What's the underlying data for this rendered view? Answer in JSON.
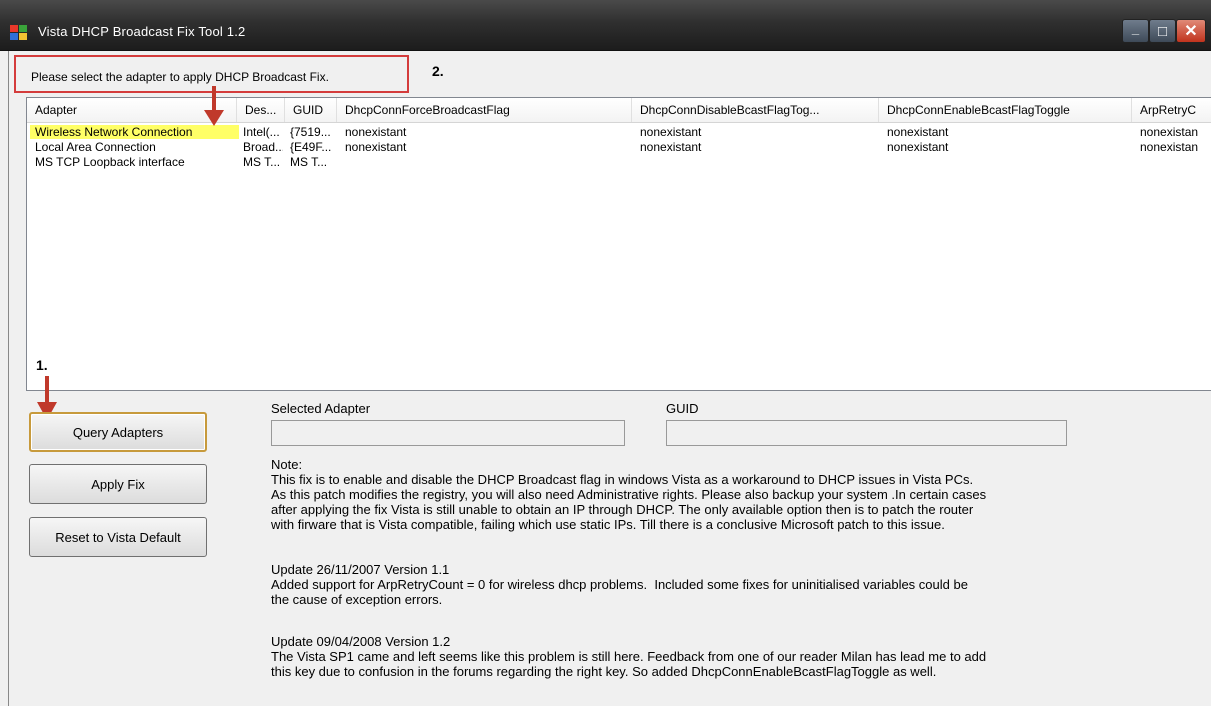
{
  "window": {
    "title": "Vista DHCP Broadcast Fix Tool 1.2",
    "controls": {
      "minimize": "_",
      "maximize": "□",
      "close": "✕"
    }
  },
  "annotations": {
    "instruction": "Please select the adapter to apply DHCP Broadcast Fix.",
    "step1": "1.",
    "step2": "2."
  },
  "listview": {
    "columns": [
      "Adapter",
      "Des...",
      "GUID",
      "DhcpConnForceBroadcastFlag",
      "DhcpConnDisableBcastFlagTog...",
      "DhcpConnEnableBcastFlagToggle",
      "ArpRetryC"
    ],
    "rows": [
      [
        "Wireless Network Connection",
        "Intel(...",
        "{7519...",
        "nonexistant",
        "nonexistant",
        "nonexistant",
        "nonexistan"
      ],
      [
        "Local Area Connection",
        "Broad...",
        "{E49F...",
        "nonexistant",
        "nonexistant",
        "nonexistant",
        "nonexistan"
      ],
      [
        "MS TCP Loopback interface",
        "MS T...",
        "MS T...",
        "",
        "",
        "",
        ""
      ]
    ]
  },
  "buttons": {
    "query": "Query Adapters",
    "apply": "Apply Fix",
    "reset": "Reset to Vista Default"
  },
  "fields": {
    "selected_adapter_label": "Selected Adapter",
    "selected_adapter_value": "",
    "guid_label": "GUID",
    "guid_value": ""
  },
  "notes": {
    "note_header": "Note:",
    "note_body": "This fix is to enable and disable the DHCP Broadcast flag in windows Vista as a workaround to DHCP issues in Vista PCs.\nAs this patch modifies the registry, you will also need Administrative rights. Please also backup your system .In certain cases\nafter applying the fix Vista is still unable to obtain an IP through DHCP. The only available option then is to patch the router\nwith firware that is Vista compatible, failing which use static IPs. Till there is a conclusive Microsoft patch to this issue.",
    "update1_header": "Update 26/11/2007 Version 1.1",
    "update1_body": "Added support for ArpRetryCount = 0 for wireless dhcp problems.  Included some fixes for uninitialised variables could be\nthe cause of exception errors.",
    "update2_header": "Update 09/04/2008 Version 1.2",
    "update2_body": "The Vista SP1 came and left seems like this problem is still here. Feedback from one of our reader Milan has lead me to add\nthis key due to confusion in the forums regarding the right key. So added DhcpConnEnableBcastFlagToggle as well."
  },
  "colors": {
    "highlight": "#ffff66",
    "annotation_red": "#d43c3c"
  }
}
